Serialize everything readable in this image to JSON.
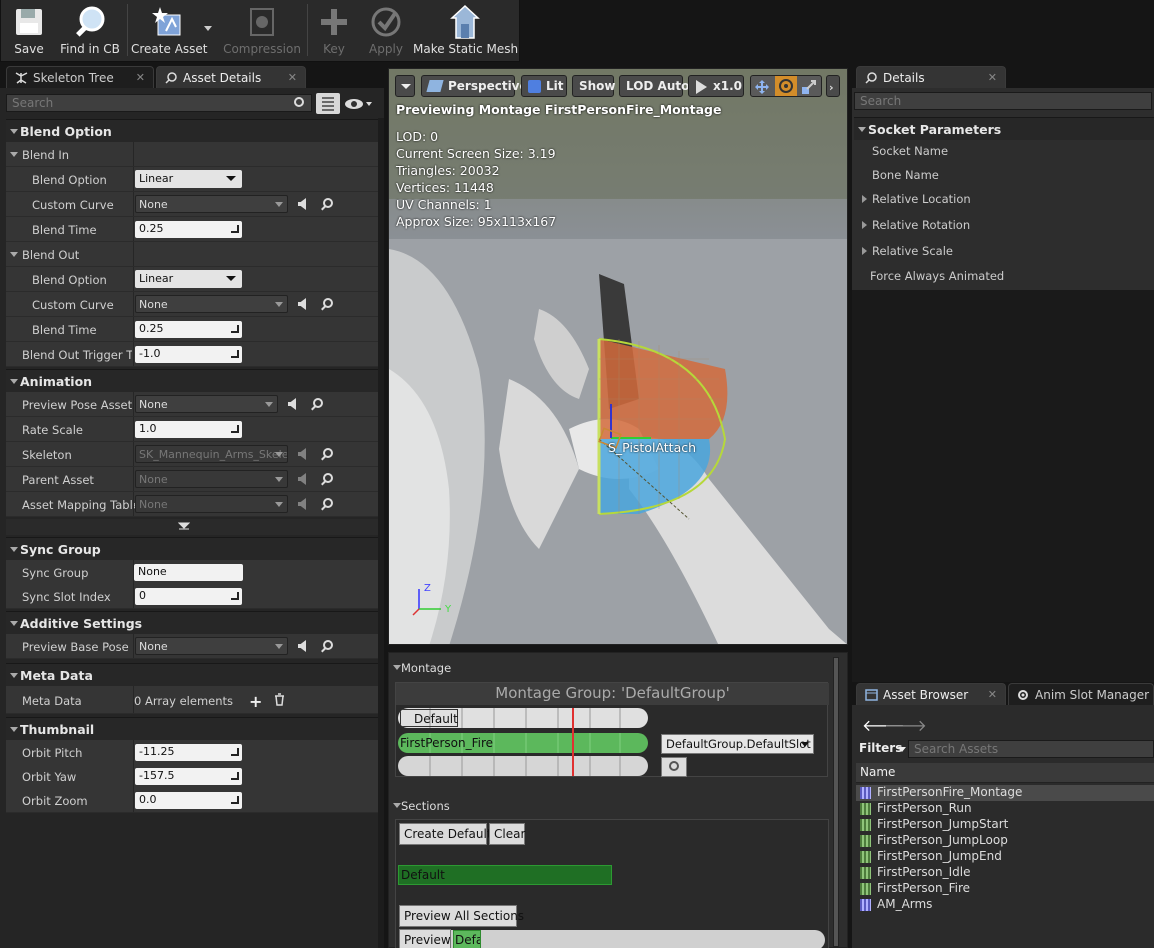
{
  "toolbar": {
    "save": "Save",
    "find_in_cb": "Find in CB",
    "create_asset": "Create Asset",
    "compression": "Compression",
    "key": "Key",
    "apply": "Apply",
    "make_static_mesh": "Make Static Mesh"
  },
  "left_tabs": {
    "skeleton_tree": "Skeleton Tree",
    "asset_details": "Asset Details"
  },
  "left_search": {
    "placeholder": "Search"
  },
  "blend_option": {
    "title": "Blend Option",
    "blend_in": "Blend In",
    "blend_out": "Blend Out",
    "blend_option_label": "Blend Option",
    "custom_curve_label": "Custom Curve",
    "blend_time_label": "Blend Time",
    "in_option": "Linear",
    "in_curve": "None",
    "in_time": "0.25",
    "out_option": "Linear",
    "out_curve": "None",
    "out_time": "0.25",
    "trigger_label": "Blend Out Trigger Tin",
    "trigger_value": "-1.0"
  },
  "animation": {
    "title": "Animation",
    "preview_pose_label": "Preview Pose Asset",
    "preview_pose_value": "None",
    "rate_scale_label": "Rate Scale",
    "rate_scale_value": "1.0",
    "skeleton_label": "Skeleton",
    "skeleton_value": "SK_Mannequin_Arms_Skele",
    "parent_asset_label": "Parent Asset",
    "parent_asset_value": "None",
    "mapping_label": "Asset Mapping Table",
    "mapping_value": "None"
  },
  "sync_group": {
    "title": "Sync Group",
    "group_label": "Sync Group",
    "group_value": "None",
    "slot_label": "Sync Slot Index",
    "slot_value": "0"
  },
  "additive": {
    "title": "Additive Settings",
    "base_pose_label": "Preview Base Pose",
    "base_pose_value": "None"
  },
  "meta": {
    "title": "Meta Data",
    "label": "Meta Data",
    "value": "0 Array elements"
  },
  "thumbnail": {
    "title": "Thumbnail",
    "pitch_label": "Orbit Pitch",
    "pitch_value": "-11.25",
    "yaw_label": "Orbit Yaw",
    "yaw_value": "-157.5",
    "zoom_label": "Orbit Zoom",
    "zoom_value": "0.0"
  },
  "viewport": {
    "perspective": "Perspective",
    "lit": "Lit",
    "show": "Show",
    "lod": "LOD Auto",
    "speed": "x1.0",
    "previewing": "Previewing Montage FirstPersonFire_Montage",
    "lod_line": "LOD: 0",
    "screen_size": "Current Screen Size: 3.19",
    "triangles": "Triangles: 20032",
    "vertices": "Vertices: 11448",
    "uv_channels": "UV Channels: 1",
    "approx_size": "Approx Size: 95x113x167",
    "socket_label": "S_PistolAttach",
    "axis_z": "Z",
    "axis_y": "Y"
  },
  "montage": {
    "section_title": "Montage",
    "group_title": "Montage Group: 'DefaultGroup'",
    "default_track": "Default",
    "anim_track": "FirstPerson_Fire",
    "slot_dropdown": "DefaultGroup.DefaultSlot",
    "sections_title": "Sections",
    "create_default": "Create Default",
    "clear": "Clear",
    "section_default": "Default",
    "preview_all": "Preview All Sections",
    "preview": "Preview",
    "preview_seg": "Defa"
  },
  "details": {
    "tab": "Details",
    "search_placeholder": "Search",
    "socket_params": "Socket Parameters",
    "socket_name": "Socket Name",
    "bone_name": "Bone Name",
    "relative_location": "Relative Location",
    "relative_rotation": "Relative Rotation",
    "relative_scale": "Relative Scale",
    "force_animated": "Force Always Animated"
  },
  "asset_browser": {
    "tab": "Asset Browser",
    "slot_tab": "Anim Slot Manager",
    "filters": "Filters",
    "search_placeholder": "Search Assets",
    "column_name": "Name",
    "items": [
      "FirstPersonFire_Montage",
      "FirstPerson_Run",
      "FirstPerson_JumpStart",
      "FirstPerson_JumpLoop",
      "FirstPerson_JumpEnd",
      "FirstPerson_Idle",
      "FirstPerson_Fire",
      "AM_Arms"
    ]
  }
}
